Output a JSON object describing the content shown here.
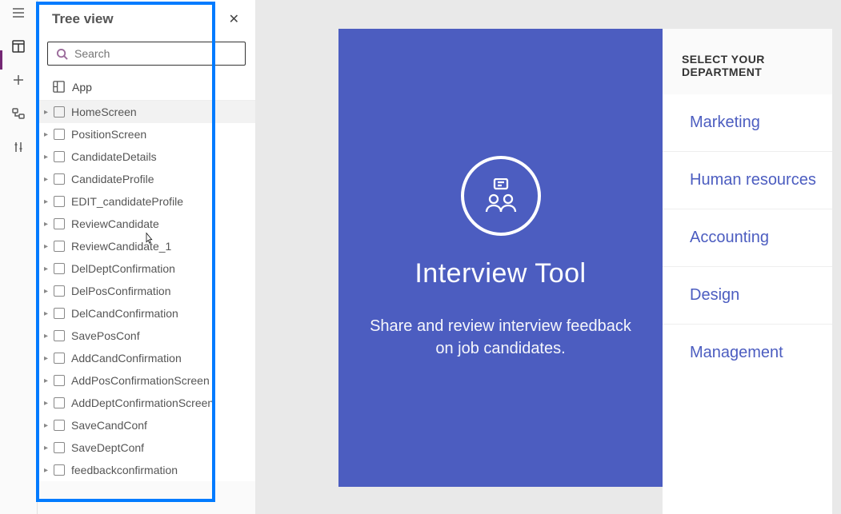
{
  "panel": {
    "title": "Tree view",
    "search_placeholder": "Search",
    "app_label": "App",
    "items": [
      {
        "label": "HomeScreen",
        "selected": true,
        "more": true
      },
      {
        "label": "PositionScreen"
      },
      {
        "label": "CandidateDetails"
      },
      {
        "label": "CandidateProfile"
      },
      {
        "label": "EDIT_candidateProfile"
      },
      {
        "label": "ReviewCandidate",
        "more": true
      },
      {
        "label": "ReviewCandidate_1"
      },
      {
        "label": "DelDeptConfirmation"
      },
      {
        "label": "DelPosConfirmation"
      },
      {
        "label": "DelCandConfirmation"
      },
      {
        "label": "SavePosConf"
      },
      {
        "label": "AddCandConfirmation"
      },
      {
        "label": "AddPosConfirmationScreen"
      },
      {
        "label": "AddDeptConfirmationScreen"
      },
      {
        "label": "SaveCandConf"
      },
      {
        "label": "SaveDeptConf"
      },
      {
        "label": "feedbackconfirmation"
      }
    ]
  },
  "preview": {
    "title": "Interview Tool",
    "subtitle": "Share and review interview feedback on job candidates."
  },
  "dept": {
    "heading": "SELECT YOUR DEPARTMENT",
    "items": [
      "Marketing",
      "Human resources",
      "Accounting",
      "Design",
      "Management"
    ]
  }
}
